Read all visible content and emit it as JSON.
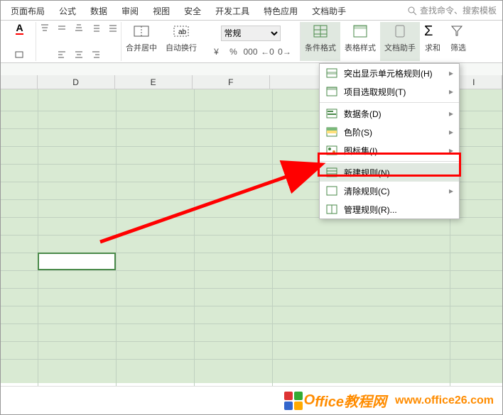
{
  "ribbon_tabs": {
    "t0": "页面布局",
    "t1": "公式",
    "t2": "数据",
    "t3": "审阅",
    "t4": "视图",
    "t5": "安全",
    "t6": "开发工具",
    "t7": "特色应用",
    "t8": "文档助手"
  },
  "search_placeholder": "查找命令、搜索模板",
  "ribbon": {
    "merge": "合并居中",
    "wrap": "自动换行",
    "nf_general": "常规",
    "cond": "条件格式",
    "tblstyle": "表格样式",
    "wdoc": "文档助手",
    "sum": "求和",
    "filter": "筛选"
  },
  "cols": {
    "d": "D",
    "e": "E",
    "f": "F",
    "i": "I"
  },
  "dd": {
    "i0": "突出显示单元格规则(H)",
    "i1": "项目选取规则(T)",
    "i2": "数据条(D)",
    "i3": "色阶(S)",
    "i4": "图标集(I)",
    "i5": "新建规则(N)...",
    "i6": "清除规则(C)",
    "i7": "管理规则(R)..."
  },
  "footer": {
    "brand_o": "O",
    "brand_text": "ffice教程网",
    "url": "www.office26.com"
  }
}
